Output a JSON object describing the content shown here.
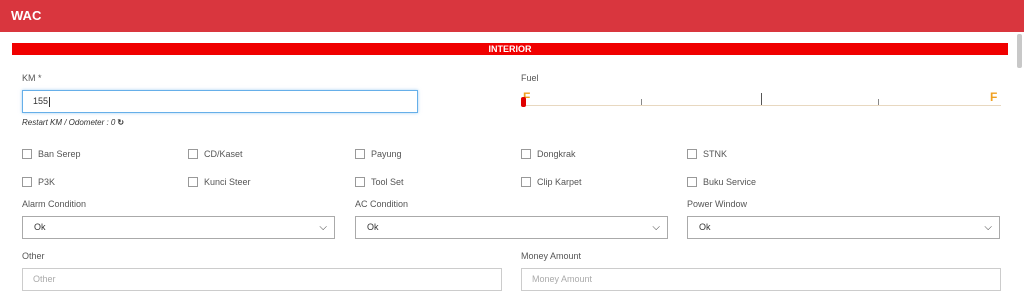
{
  "header": {
    "title": "WAC"
  },
  "section": {
    "title": "INTERIOR"
  },
  "km": {
    "label": "KM *",
    "value": "155",
    "restart_text": "Restart KM / Odometer : 0"
  },
  "fuel": {
    "label": "Fuel",
    "left_mark": "F",
    "right_mark": "F",
    "level": 0
  },
  "checkboxes": [
    {
      "label": "Ban Serep",
      "checked": false
    },
    {
      "label": "CD/Kaset",
      "checked": false
    },
    {
      "label": "Payung",
      "checked": false
    },
    {
      "label": "Dongkrak",
      "checked": false
    },
    {
      "label": "STNK",
      "checked": false
    },
    {
      "label": "P3K",
      "checked": false
    },
    {
      "label": "Kunci Steer",
      "checked": false
    },
    {
      "label": "Tool Set",
      "checked": false
    },
    {
      "label": "Clip Karpet",
      "checked": false
    },
    {
      "label": "Buku Service",
      "checked": false
    }
  ],
  "alarm": {
    "label": "Alarm Condition",
    "value": "Ok"
  },
  "ac": {
    "label": "AC Condition",
    "value": "Ok"
  },
  "power_window": {
    "label": "Power Window",
    "value": "Ok"
  },
  "other": {
    "label": "Other",
    "placeholder": "Other"
  },
  "money": {
    "label": "Money Amount",
    "placeholder": "Money Amount"
  },
  "icons": {
    "refresh": "refresh-icon",
    "chevron": "chevron-down-icon"
  }
}
